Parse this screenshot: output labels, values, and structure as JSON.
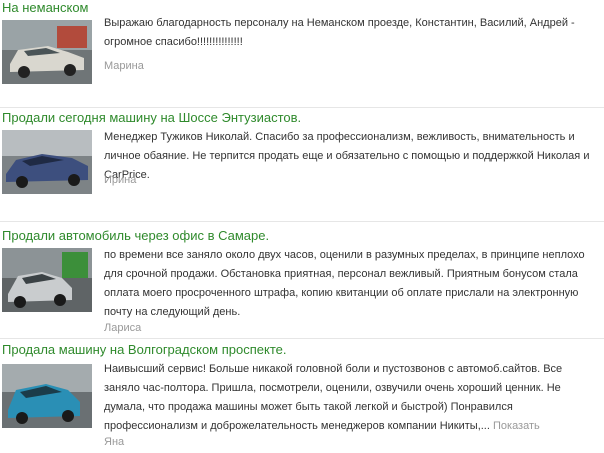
{
  "reviews": [
    {
      "title": "На неманском",
      "text": "Выражаю благодарность персоналу на Неманском проезде, Константин, Василий, Андрей - огромное спасибо!!!!!!!!!!!!!!!",
      "author": "Марина",
      "car_color": "#d9d7cf"
    },
    {
      "title": "Продали сегодня машину на Шоссе Энтузиастов.",
      "text": "Менеджер Тужиков Николай. Спасибо за профессионализм, вежливость, внимательность и личное обаяние. Не терпится продать еще и обязательно с помощью и поддержкой Николая и CarPrice.",
      "author": "Ирина",
      "car_color": "#3d4f7e"
    },
    {
      "title": "Продали автомобиль через офис в Самаре.",
      "text": "по времени все заняло около двух часов, оценили в разумных пределах, в принципе неплохо для срочной продажи. Обстановка приятная, персонал вежливый. Приятным бонусом стала оплата моего просроченного штрафа, копию квитанции об оплате прислали на электронную почту на следующий день.",
      "author": "Лариса",
      "car_color": "#c9ccce"
    },
    {
      "title": "Продала машину на Волгоградском проспекте.",
      "text": "Наивысший сервис! Больше никакой головной боли и пустозвонов с автомоб.сайтов. Все заняло час-полтора. Пришла, посмотрели, оценили, озвучили очень хороший ценник. Не думала, что продажа машины может быть такой легкой и быстрой) Понравился профессионализм и доброжелательность менеджеров компании Никиты,...",
      "more_label": "Показать",
      "author": "Яна",
      "car_color": "#2a8fb5"
    }
  ]
}
